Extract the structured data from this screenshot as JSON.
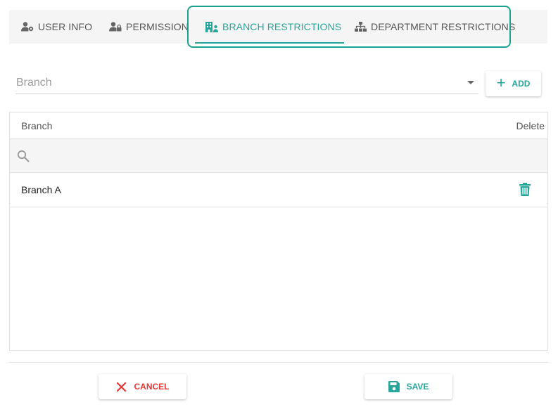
{
  "tabs": [
    {
      "label": "USER INFO",
      "icon": "user-gear-icon",
      "active": false
    },
    {
      "label": "PERMISSION",
      "icon": "user-lock-icon",
      "active": false
    },
    {
      "label": "BRANCH RESTRICTIONS",
      "icon": "building-user-icon",
      "active": true
    },
    {
      "label": "DEPARTMENT RESTRICTIONS",
      "icon": "sitemap-icon",
      "active": false
    }
  ],
  "colors": {
    "accent": "#26a69a",
    "highlight": "#1aa190",
    "danger": "#e53935"
  },
  "branch_select": {
    "placeholder": "Branch"
  },
  "add_button": {
    "label": "ADD",
    "icon": "plus-icon"
  },
  "table": {
    "columns": [
      "Branch",
      "Delete"
    ],
    "filter_icon": "search-icon",
    "rows": [
      {
        "branch": "Branch A",
        "delete_icon": "trash-icon"
      }
    ]
  },
  "footer": {
    "cancel_label": "CANCEL",
    "save_label": "SAVE"
  }
}
